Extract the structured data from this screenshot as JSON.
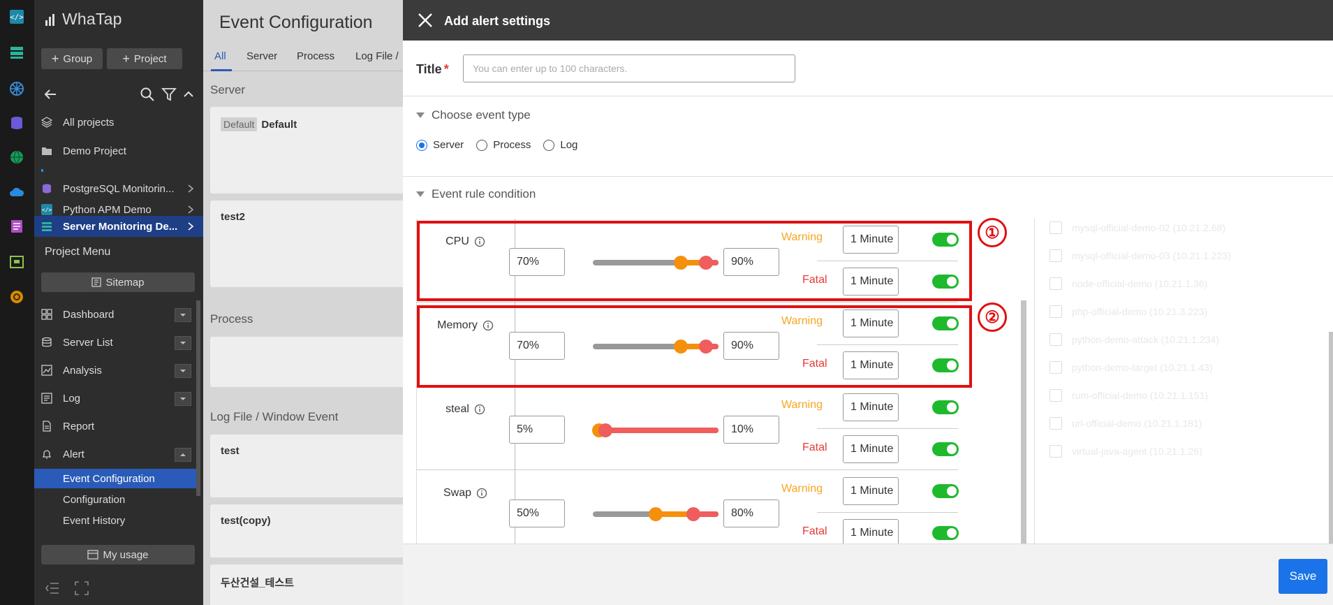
{
  "brand": {
    "name": "WhaTap"
  },
  "sidenav": {
    "group_label": "Group",
    "project_label": "Project",
    "items": [
      {
        "label": "All projects",
        "icon": "layers-icon"
      },
      {
        "label": "Demo Project",
        "icon": "folder-icon"
      },
      {
        "label": "PostgreSQL Monitorin...",
        "icon": "database-icon"
      },
      {
        "label": "Python APM Demo",
        "icon": "code-icon"
      },
      {
        "label": "Server Monitoring De...",
        "icon": "server-icon"
      }
    ],
    "project_menu_title": "Project Menu",
    "sitemap_label": "Sitemap",
    "menu": [
      {
        "label": "Dashboard",
        "icon": "grid-icon"
      },
      {
        "label": "Server List",
        "icon": "server-icon"
      },
      {
        "label": "Analysis",
        "icon": "chart-icon"
      },
      {
        "label": "Log",
        "icon": "log-icon"
      },
      {
        "label": "Report",
        "icon": "report-icon"
      },
      {
        "label": "Alert",
        "icon": "bell-icon"
      }
    ],
    "alert_sub": [
      "Event Configuration",
      "Configuration",
      "Event History"
    ],
    "my_usage_label": "My usage"
  },
  "bgpage": {
    "title": "Event Configuration",
    "tabs": [
      "All",
      "Server",
      "Process",
      "Log File /"
    ],
    "groups": [
      "Server",
      "Process",
      "Log File / Window Event"
    ],
    "cards": [
      {
        "badge": "Default",
        "title": "Default"
      },
      {
        "title": "test2"
      },
      {
        "title": "test"
      },
      {
        "title": "test(copy)"
      },
      {
        "title": "두산건설_테스트"
      }
    ]
  },
  "modal": {
    "title": "Add alert settings",
    "title_label": "Title",
    "title_required": "*",
    "title_placeholder": "You can enter up to 100 characters.",
    "event_type_header": "Choose event type",
    "event_types": [
      {
        "label": "Server",
        "checked": true
      },
      {
        "label": "Process",
        "checked": false
      },
      {
        "label": "Log",
        "checked": false
      }
    ],
    "rule_header": "Event rule condition",
    "warning_label": "Warning",
    "fatal_label": "Fatal",
    "rules": [
      {
        "name": "CPU",
        "warn": "70%",
        "fatal": "90%",
        "warn_value": 70,
        "fatal_value": 90,
        "warn_duration": "1 Minute",
        "fatal_duration": "1 Minute",
        "warn_on": true,
        "fatal_on": true
      },
      {
        "name": "Memory",
        "warn": "70%",
        "fatal": "90%",
        "warn_value": 70,
        "fatal_value": 90,
        "warn_duration": "1 Minute",
        "fatal_duration": "1 Minute",
        "warn_on": true,
        "fatal_on": true
      },
      {
        "name": "steal",
        "warn": "5%",
        "fatal": "10%",
        "warn_value": 5,
        "fatal_value": 10,
        "warn_duration": "1 Minute",
        "fatal_duration": "1 Minute",
        "warn_on": true,
        "fatal_on": true
      },
      {
        "name": "Swap",
        "warn": "50%",
        "fatal": "80%",
        "warn_value": 50,
        "fatal_value": 80,
        "warn_duration": "1 Minute",
        "fatal_duration": "1 Minute",
        "warn_on": true,
        "fatal_on": true
      }
    ],
    "callouts": [
      "①",
      "②"
    ],
    "targets": [
      "mysql-official-demo-02 (10.21.2.68)",
      "mysql-official-demo-03 (10.21.1.223)",
      "node-official-demo (10.21.1.36)",
      "php-official-demo (10.21.3.223)",
      "python-demo-attack (10.21.1.234)",
      "python-demo-target (10.21.1.43)",
      "rum-official-demo (10.21.1.151)",
      "url-official-demo (10.21.1.181)",
      "virtual-java-agent (10.21.1.26)"
    ],
    "save_label": "Save"
  },
  "colors": {
    "accent": "#1a73e8",
    "warning": "#f5a623",
    "fatal": "#e53935",
    "toggle_on": "#1fb92e",
    "highlight": "#e01010"
  }
}
